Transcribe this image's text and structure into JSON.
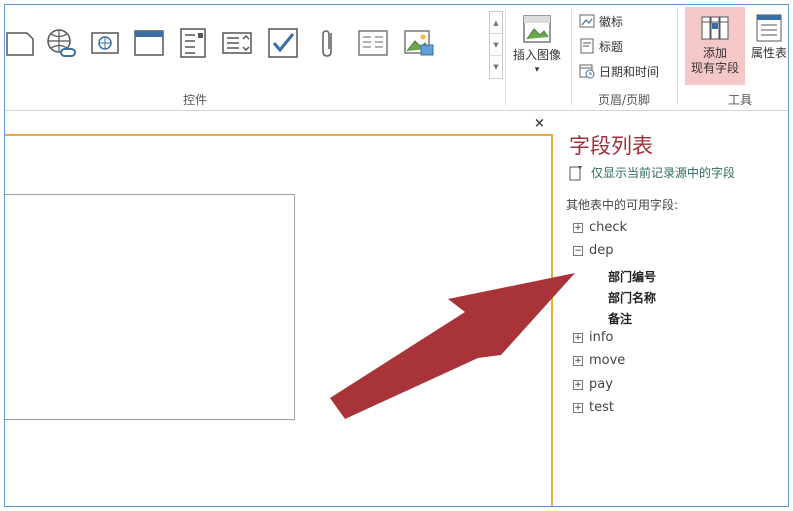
{
  "ribbon": {
    "controls_group_label": "控件",
    "insert_image_label": "插入图像",
    "header_footer": {
      "logo_label": "徽标",
      "title_label": "标题",
      "datetime_label": "日期和时间",
      "group_label": "页眉/页脚"
    },
    "tools": {
      "add_existing_fields_label_1": "添加",
      "add_existing_fields_label_2": "现有字段",
      "property_sheet_label": "属性表",
      "group_label": "工具"
    }
  },
  "form": {
    "close_glyph": "×"
  },
  "field_list": {
    "title": "字段列表",
    "show_only_current": "仅显示当前记录源中的字段",
    "available_label": "其他表中的可用字段:",
    "tables": [
      {
        "name": "check",
        "expanded": false
      },
      {
        "name": "dep",
        "expanded": true,
        "fields": [
          "部门编号",
          "部门名称",
          "备注"
        ]
      },
      {
        "name": "info",
        "expanded": false
      },
      {
        "name": "move",
        "expanded": false
      },
      {
        "name": "pay",
        "expanded": false
      },
      {
        "name": "test",
        "expanded": false
      }
    ]
  },
  "colors": {
    "accent_title": "#a0303a",
    "highlight": "#f4c7c8",
    "form_border": "#e8a93d",
    "arrow": "#a8343a"
  }
}
